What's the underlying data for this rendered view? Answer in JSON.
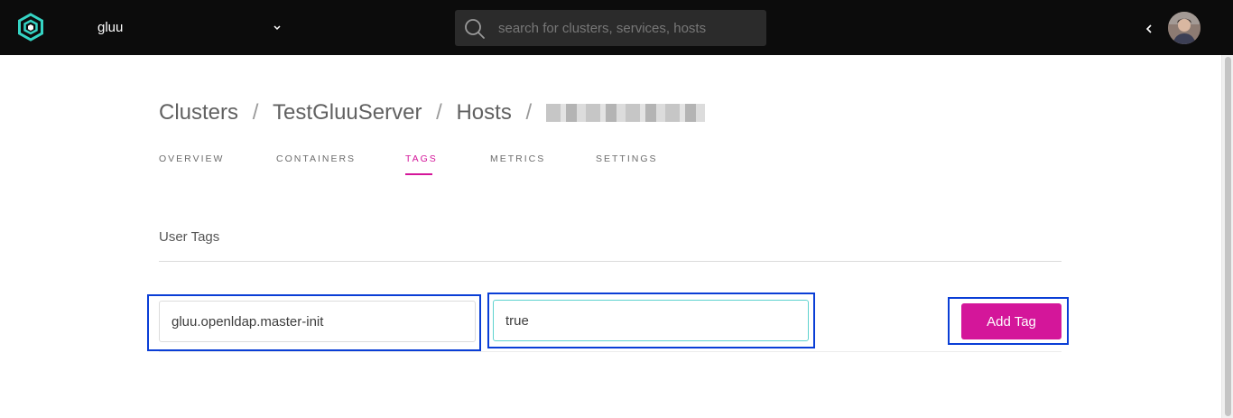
{
  "header": {
    "logo_icon": "gluu-hex-logo",
    "org_name": "gluu",
    "org_chevron_icon": "chevron-down-icon",
    "search": {
      "placeholder": "search for clusters, services, hosts",
      "value": ""
    },
    "collapse_icon": "chevron-left-icon",
    "avatar_icon": "user-avatar"
  },
  "breadcrumb": {
    "items": [
      "Clusters",
      "TestGluuServer",
      "Hosts"
    ],
    "separator": "/",
    "last_item_redacted": true
  },
  "tabs": [
    {
      "label": "OVERVIEW",
      "active": false
    },
    {
      "label": "CONTAINERS",
      "active": false
    },
    {
      "label": "TAGS",
      "active": true
    },
    {
      "label": "METRICS",
      "active": false
    },
    {
      "label": "SETTINGS",
      "active": false
    }
  ],
  "user_tags": {
    "title": "User Tags",
    "key_value": "gluu.openldap.master-init",
    "value_value": "true",
    "add_button": "Add Tag"
  },
  "colors": {
    "topbar": "#0c0c0c",
    "accent": "#d4169a",
    "logo_teal": "#35d4c4",
    "highlight": "#0a3ed6",
    "focus_border": "#5fd3cf"
  }
}
